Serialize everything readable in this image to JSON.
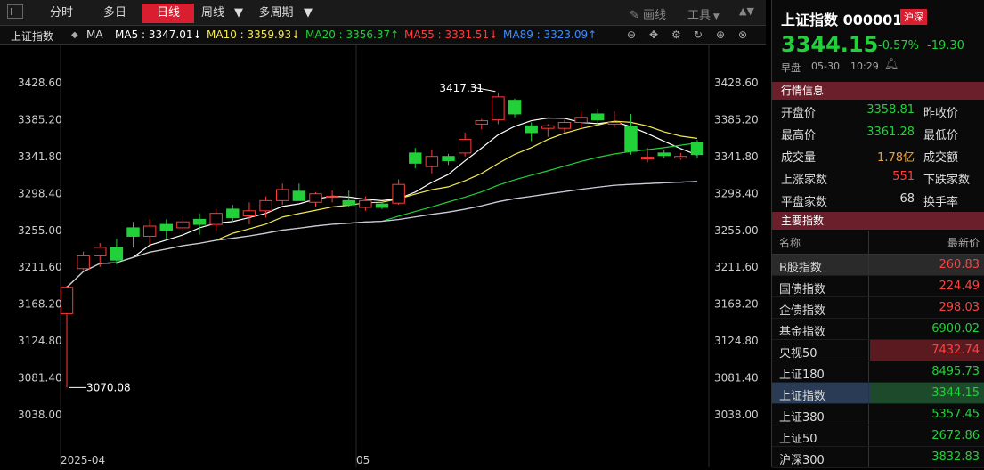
{
  "toolbar": {
    "tabs": [
      {
        "label": "分时",
        "dropdown": false,
        "active": false
      },
      {
        "label": "多日",
        "dropdown": false,
        "active": false
      },
      {
        "label": "日线",
        "dropdown": false,
        "active": true
      },
      {
        "label": "周线",
        "dropdown": true,
        "active": false
      },
      {
        "label": "多周期",
        "dropdown": true,
        "active": false
      }
    ],
    "draw_label": "画线",
    "tools_label": "工具"
  },
  "ma_bar": {
    "index_name": "上证指数",
    "ma_label": "MA",
    "items": [
      {
        "text": "MA5 : 3347.01↓",
        "color": "#ffffff"
      },
      {
        "text": "MA10 : 3359.93↓",
        "color": "#f5e94f"
      },
      {
        "text": "MA20 : 3356.37↑",
        "color": "#22d03a"
      },
      {
        "text": "MA55 : 3331.51↓",
        "color": "#ff3b3b"
      },
      {
        "text": "MA89 : 3323.09↑",
        "color": "#3a8cff"
      }
    ]
  },
  "chart_data": {
    "type": "candlestick",
    "ylim": [
      3038.0,
      3428.6
    ],
    "y_ticks": [
      "3428.60",
      "3385.20",
      "3341.80",
      "3298.40",
      "3255.00",
      "3211.60",
      "3168.20",
      "3124.80",
      "3081.40",
      "3038.00"
    ],
    "x_labels": [
      "2025-04",
      "05"
    ],
    "annotations": [
      {
        "text": "3417.31"
      },
      {
        "text": "3070.08"
      }
    ],
    "candles": [
      [
        3157,
        3190,
        3070.08,
        3188
      ],
      [
        3210,
        3230,
        3208,
        3225
      ],
      [
        3225,
        3240,
        3212,
        3235
      ],
      [
        3235,
        3245,
        3215,
        3220
      ],
      [
        3258,
        3265,
        3235,
        3248
      ],
      [
        3248,
        3268,
        3238,
        3260
      ],
      [
        3262,
        3268,
        3245,
        3255
      ],
      [
        3258,
        3272,
        3242,
        3265
      ],
      [
        3268,
        3275,
        3250,
        3262
      ],
      [
        3262,
        3280,
        3255,
        3275
      ],
      [
        3280,
        3285,
        3265,
        3270
      ],
      [
        3272,
        3288,
        3262,
        3278
      ],
      [
        3278,
        3295,
        3270,
        3290
      ],
      [
        3290,
        3310,
        3285,
        3303
      ],
      [
        3301,
        3310,
        3295,
        3290
      ],
      [
        3288,
        3300,
        3283,
        3298
      ],
      [
        3295,
        3302,
        3288,
        3295
      ],
      [
        3290,
        3302,
        3282,
        3285
      ],
      [
        3282,
        3295,
        3278,
        3290
      ],
      [
        3286,
        3288,
        3280,
        3282
      ],
      [
        3287,
        3315,
        3285,
        3309
      ],
      [
        3346,
        3352,
        3328,
        3334
      ],
      [
        3330,
        3350,
        3322,
        3342
      ],
      [
        3342,
        3345,
        3332,
        3337
      ],
      [
        3346,
        3370,
        3342,
        3362
      ],
      [
        3380,
        3386,
        3374,
        3384
      ],
      [
        3385,
        3417.31,
        3380,
        3412
      ],
      [
        3408,
        3410,
        3388,
        3392
      ],
      [
        3378,
        3382,
        3360,
        3370
      ],
      [
        3375,
        3380,
        3365,
        3378
      ],
      [
        3375,
        3385,
        3370,
        3382
      ],
      [
        3382,
        3395,
        3376,
        3388
      ],
      [
        3392,
        3398,
        3378,
        3385
      ],
      [
        3380,
        3395,
        3376,
        3382
      ],
      [
        3377,
        3392,
        3344,
        3348
      ],
      [
        3339,
        3352,
        3335,
        3341
      ],
      [
        3346,
        3350,
        3340,
        3343
      ],
      [
        3340,
        3346,
        3338,
        3342
      ],
      [
        3358.81,
        3361.28,
        3340,
        3344.15
      ]
    ],
    "ma_series": [
      {
        "name": "MA5",
        "color": "#ffffff"
      },
      {
        "name": "MA10",
        "color": "#f5e94f"
      },
      {
        "name": "MA20",
        "color": "#22d03a"
      },
      {
        "name": "MA55",
        "color": "#ff3b3b"
      },
      {
        "name": "MA89",
        "color": "#3a8cff"
      },
      {
        "color": "#cccccc"
      }
    ]
  },
  "quote": {
    "title": "上证指数 000001",
    "badge": "沪深",
    "price": "3344.15",
    "change_pct": "-0.57%",
    "change": "-19.30",
    "session": "早盘",
    "date": "05-30",
    "time": "10:29"
  },
  "info": {
    "section_title": "行情信息",
    "rows": [
      {
        "k1": "开盘价",
        "v1": "3358.81",
        "c1": "#22d03a",
        "k2": "昨收价"
      },
      {
        "k1": "最高价",
        "v1": "3361.28",
        "c1": "#22d03a",
        "k2": "最低价"
      },
      {
        "k1": "成交量",
        "v1": "1.78亿",
        "c1": "#f0a030",
        "k2": "成交额"
      },
      {
        "k1": "上涨家数",
        "v1": "551",
        "c1": "#ff4040",
        "k2": "下跌家数"
      },
      {
        "k1": "平盘家数",
        "v1": "68",
        "c1": "#dddddd",
        "k2": "换手率"
      }
    ]
  },
  "indices": {
    "section_title": "主要指数",
    "col_name": "名称",
    "col_price": "最新价",
    "rows": [
      {
        "name": "B股指数",
        "price": "260.83",
        "color": "#ff4040",
        "bg": "#2a2a2a",
        "rowbg": "#2a2a2a"
      },
      {
        "name": "国债指数",
        "price": "224.49",
        "color": "#ff4040",
        "bg": "",
        "rowbg": ""
      },
      {
        "name": "企债指数",
        "price": "298.03",
        "color": "#ff4040",
        "bg": "",
        "rowbg": ""
      },
      {
        "name": "基金指数",
        "price": "6900.02",
        "color": "#22d03a",
        "bg": "",
        "rowbg": ""
      },
      {
        "name": "央视50",
        "price": "7432.74",
        "color": "#ff4040",
        "bg": "#5a1a1f",
        "rowbg": ""
      },
      {
        "name": "上证180",
        "price": "8495.73",
        "color": "#22d03a",
        "bg": "",
        "rowbg": ""
      },
      {
        "name": "上证指数",
        "price": "3344.15",
        "color": "#22d03a",
        "bg": "#1c4a2a",
        "rowbg": "#2a3b55"
      },
      {
        "name": "上证380",
        "price": "5357.45",
        "color": "#22d03a",
        "bg": "",
        "rowbg": ""
      },
      {
        "name": "上证50",
        "price": "2672.86",
        "color": "#22d03a",
        "bg": "",
        "rowbg": ""
      },
      {
        "name": "沪深300",
        "price": "3832.83",
        "color": "#22d03a",
        "bg": "",
        "rowbg": ""
      }
    ]
  }
}
